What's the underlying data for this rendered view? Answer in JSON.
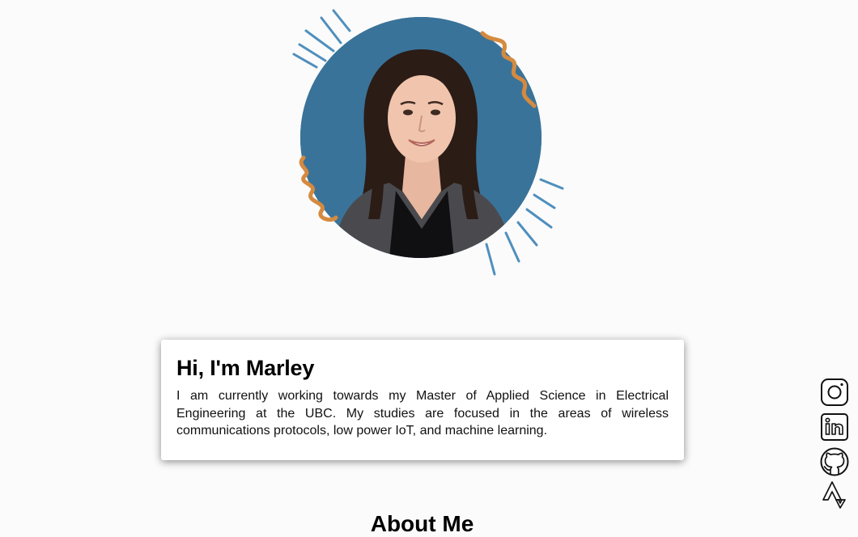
{
  "profile": {
    "photo_alt": "Portrait photo",
    "accent_colors": {
      "photo_background": "#3a7399",
      "squiggle": "#d58a3f",
      "rays": "#4f8fbd"
    }
  },
  "intro": {
    "title": "Hi, I'm Marley",
    "body": "I am currently working towards my Master of Applied Science in Electrical Engineering at the UBC. My studies are focused in the areas of wireless communications protocols, low power IoT, and machine learning."
  },
  "sections": {
    "about_heading": "About Me"
  },
  "social_links": [
    {
      "icon": "instagram-icon"
    },
    {
      "icon": "linkedin-icon"
    },
    {
      "icon": "github-icon"
    },
    {
      "icon": "strava-icon"
    }
  ]
}
